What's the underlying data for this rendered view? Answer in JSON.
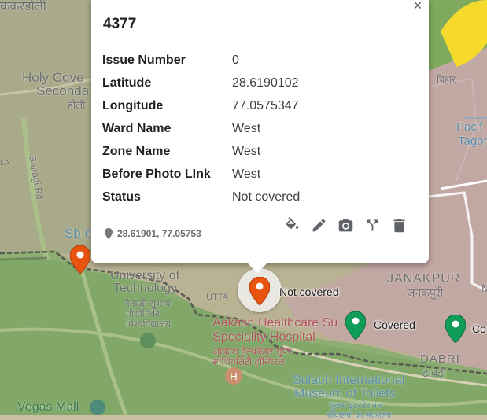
{
  "popup": {
    "title": "4377",
    "close_glyph": "×",
    "fields": [
      {
        "label": "Issue Number",
        "value": "0"
      },
      {
        "label": "Latitude",
        "value": "28.6190102"
      },
      {
        "label": "Longitude",
        "value": "77.0575347"
      },
      {
        "label": "Ward Name",
        "value": "West"
      },
      {
        "label": "Zone Name",
        "value": "West"
      },
      {
        "label": "Before Photo LInk",
        "value": "West"
      },
      {
        "label": "Status",
        "value": "Not covered"
      }
    ],
    "coords": "28.61901, 77.05753",
    "actions": [
      "paint-bucket-icon",
      "pencil-icon",
      "camera-icon",
      "directions-icon",
      "trash-icon"
    ]
  },
  "markers": [
    {
      "kind": "orange",
      "label": ""
    },
    {
      "kind": "orange-selected",
      "label": "Not covered"
    },
    {
      "kind": "green",
      "label": "Covered"
    },
    {
      "kind": "green",
      "label": "Co"
    }
  ],
  "map_labels": {
    "karkardooma": "ककरडोली",
    "holy_cove": "Holy Cove",
    "secondary": "Seconda",
    "holi": "होली",
    "bairagi_rd": "Bairagi Rd",
    "la": "LA",
    "sb": "Sb c",
    "university": "University of",
    "technology": "Technology",
    "tech_hindi": "नेताजी सुभाष",
    "tech_hindi2": "प्रौद्योगिकी",
    "tech_hindi3": "विश्वविद्यालय",
    "uttam": "UTTA",
    "aakash": "Aakash Healthcare Su",
    "speciality": "Speciality Hospital",
    "aakash_hindi": "आकाश हेल्थकेयर सुपर",
    "aakash_hindi2": "स्पेशियलिटी हॉस्पिटल",
    "janakpuri": "JANAKPUR",
    "janakpuri_hindi": "जनकपुरी",
    "pacific": "Pacif",
    "tagore": "Tagore C",
    "vihar": "विहार",
    "dabri": "DABRI",
    "dabri_hindi": "डाबड़ी",
    "sulabh": "Sulabh International",
    "museum": "Museum of Toilets",
    "sulabh_hindi": "सुलभ इंटरनेशनल",
    "sulabh_hindi2": "शौचालयों का संग्रहालय",
    "vegas": "Vegas Mall",
    "m": "M"
  },
  "colors": {
    "marker_orange": "#e8540f",
    "marker_green": "#0f9d58",
    "overlay_green": "#7fae5f",
    "overlay_pink": "#c9a7b1",
    "yellow_patch": "#f6da2b"
  }
}
